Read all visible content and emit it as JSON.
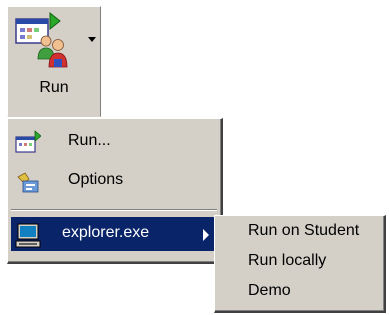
{
  "toolbar": {
    "run_label": "Run"
  },
  "menu": {
    "items": [
      {
        "label": "Run...",
        "icon": "run-window-icon"
      },
      {
        "label": "Options",
        "icon": "options-icon"
      },
      {
        "label": "explorer.exe",
        "icon": "computer-icon",
        "highlighted": true,
        "has_submenu": true
      }
    ]
  },
  "submenu": {
    "items": [
      {
        "label": "Run on Student"
      },
      {
        "label": "Run locally"
      },
      {
        "label": "Demo"
      }
    ]
  },
  "colors": {
    "menu_background": "#d4d0c8",
    "highlight": "#0a246a",
    "highlight_text": "#ffffff"
  }
}
